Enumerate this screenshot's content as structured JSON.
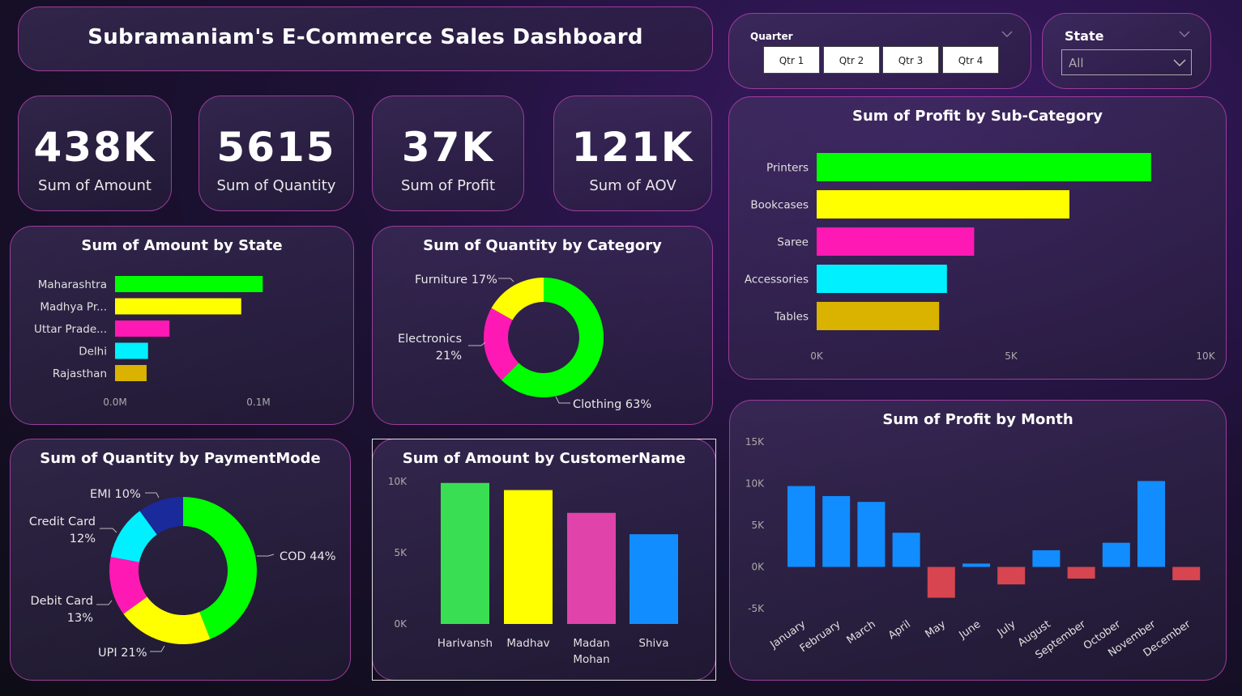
{
  "header": {
    "title": "Subramaniam's E-Commerce Sales Dashboard"
  },
  "kpis": [
    {
      "value": "438K",
      "label": "Sum of Amount"
    },
    {
      "value": "5615",
      "label": "Sum of Quantity"
    },
    {
      "value": "37K",
      "label": "Sum of Profit"
    },
    {
      "value": "121K",
      "label": "Sum of AOV"
    }
  ],
  "slicers": {
    "quarter": {
      "label": "Quarter",
      "options": [
        "Qtr 1",
        "Qtr 2",
        "Qtr 3",
        "Qtr 4"
      ]
    },
    "state": {
      "label": "State",
      "selected": "All"
    }
  },
  "colors": {
    "green": "#00ff00",
    "yellow": "#ffff00",
    "pink": "#ff19b4",
    "cyan": "#00f0ff",
    "gold": "#d9b300",
    "blue": "#118dff",
    "red": "#d64550",
    "navy": "#1a2a9a",
    "cust_green": "#3ade52",
    "cust_pink": "#e044aa"
  },
  "chart_data": [
    {
      "id": "amount_by_state",
      "type": "bar",
      "orientation": "horizontal",
      "title": "Sum of Amount by State",
      "categories": [
        "Maharashtra",
        "Madhya Pr...",
        "Uttar Prade...",
        "Delhi",
        "Rajasthan"
      ],
      "values": [
        0.103,
        0.088,
        0.038,
        0.023,
        0.022
      ],
      "colors": [
        "#00ff00",
        "#ffff00",
        "#ff19b4",
        "#00f0ff",
        "#d9b300"
      ],
      "xlim": [
        0,
        0.1
      ],
      "tick_labels": [
        "0.0M",
        "0.1M"
      ]
    },
    {
      "id": "quantity_by_category",
      "type": "pie",
      "variant": "donut",
      "title": "Sum of Quantity by Category",
      "labels": [
        "Clothing",
        "Electronics",
        "Furniture"
      ],
      "values": [
        63,
        21,
        17
      ],
      "display": [
        "Clothing 63%",
        "Electronics",
        "21%",
        "Furniture 17%"
      ],
      "colors": [
        "#00ff00",
        "#ff19b4",
        "#ffff00"
      ]
    },
    {
      "id": "profit_by_subcategory",
      "type": "bar",
      "orientation": "horizontal",
      "title": "Sum of Profit by Sub-Category",
      "categories": [
        "Printers",
        "Bookcases",
        "Saree",
        "Accessories",
        "Tables"
      ],
      "values": [
        8600,
        6500,
        4050,
        3350,
        3150
      ],
      "colors": [
        "#00ff00",
        "#ffff00",
        "#ff19b4",
        "#00f0ff",
        "#d9b300"
      ],
      "xlim": [
        0,
        10000
      ],
      "tick_labels": [
        "0K",
        "5K",
        "10K"
      ]
    },
    {
      "id": "quantity_by_paymentmode",
      "type": "pie",
      "variant": "donut",
      "title": "Sum of Quantity by PaymentMode",
      "labels": [
        "COD",
        "UPI",
        "Debit Card",
        "Credit Card",
        "EMI"
      ],
      "values": [
        44,
        21,
        13,
        12,
        10
      ],
      "display": [
        "COD 44%",
        "UPI 21%",
        "Debit Card",
        "13%",
        "Credit Card",
        "12%",
        "EMI 10%"
      ],
      "colors": [
        "#00ff00",
        "#ffff00",
        "#ff19b4",
        "#00f0ff",
        "#1a2a9a"
      ]
    },
    {
      "id": "amount_by_customer",
      "type": "bar",
      "orientation": "vertical",
      "title": "Sum of Amount by CustomerName",
      "categories": [
        "Harivansh",
        "Madhav",
        "Madan Mohan",
        "Shiva"
      ],
      "category_lines": [
        [
          "Harivansh"
        ],
        [
          "Madhav"
        ],
        [
          "Madan",
          "Mohan"
        ],
        [
          "Shiva"
        ]
      ],
      "values": [
        9900,
        9400,
        7800,
        6300
      ],
      "colors": [
        "#3ade52",
        "#ffff00",
        "#e044aa",
        "#118dff"
      ],
      "ylim": [
        0,
        10000
      ],
      "tick_labels": [
        "0K",
        "5K",
        "10K"
      ]
    },
    {
      "id": "profit_by_month",
      "type": "bar",
      "orientation": "vertical",
      "title": "Sum of Profit by Month",
      "categories": [
        "January",
        "February",
        "March",
        "April",
        "May",
        "June",
        "July",
        "August",
        "September",
        "October",
        "November",
        "December"
      ],
      "values": [
        9700,
        8500,
        7800,
        4100,
        -3700,
        400,
        -2100,
        2000,
        -1400,
        2900,
        10300,
        -1600
      ],
      "positive_color": "#118dff",
      "negative_color": "#d64550",
      "ylim": [
        -5000,
        15000
      ],
      "tick_labels": [
        "-5K",
        "0K",
        "5K",
        "10K",
        "15K"
      ]
    }
  ]
}
